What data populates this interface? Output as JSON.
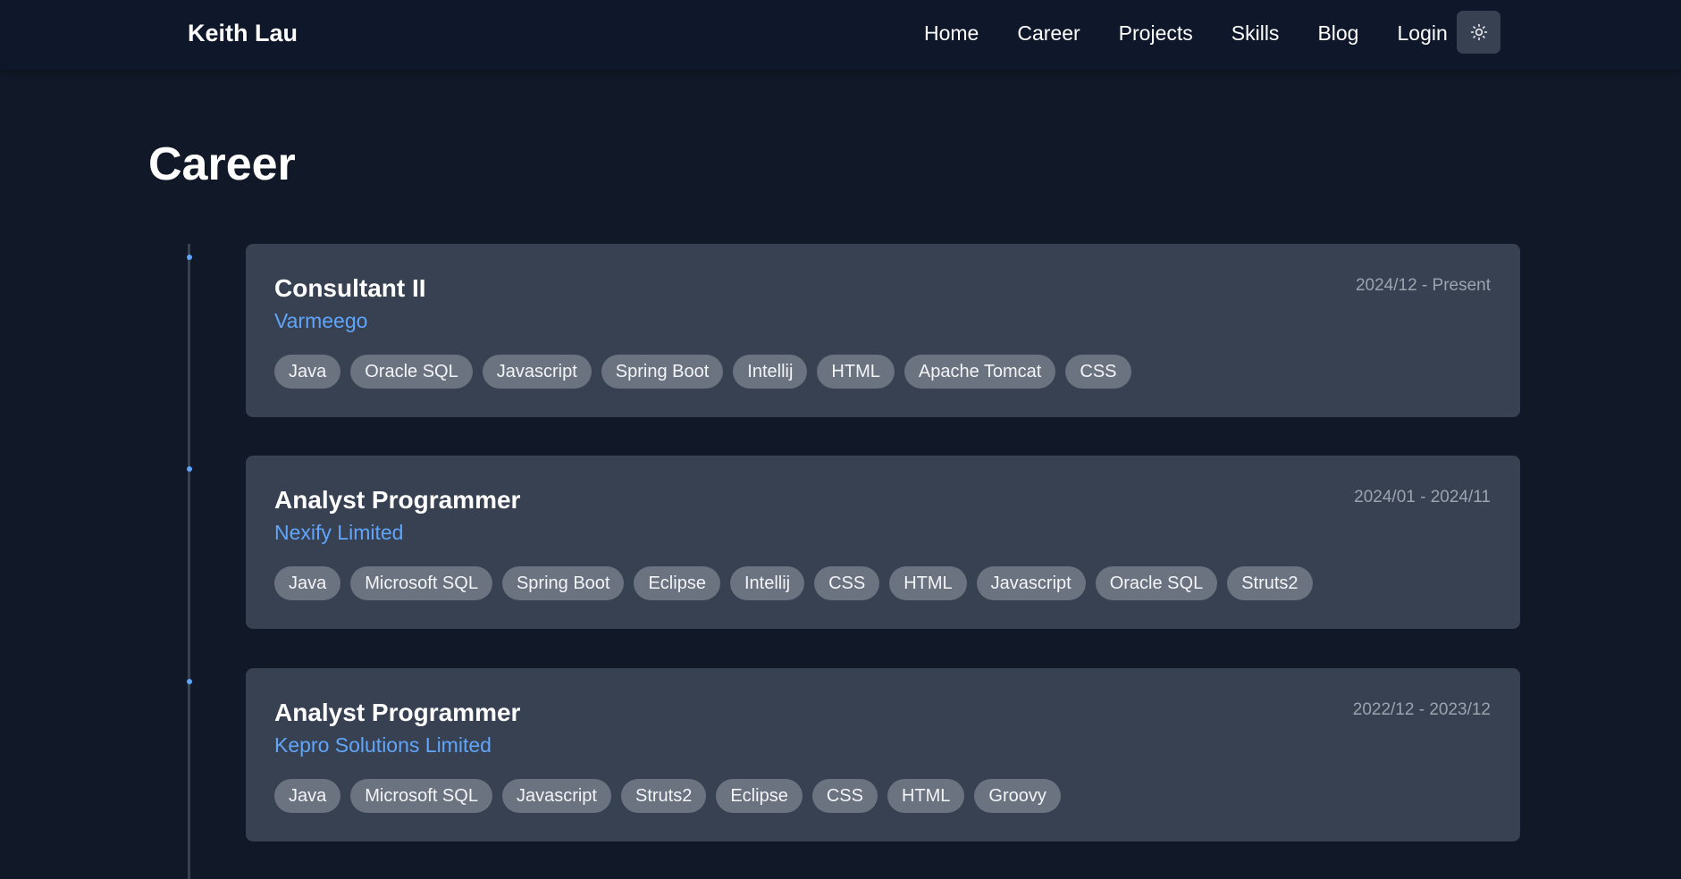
{
  "navbar": {
    "brand": "Keith Lau",
    "links": [
      "Home",
      "Career",
      "Projects",
      "Skills",
      "Blog",
      "Login"
    ],
    "theme_toggle_icon": "sun-icon"
  },
  "page": {
    "title": "Career"
  },
  "colors": {
    "background": "#111827",
    "navbar": "#0f172a",
    "card": "#374151",
    "accent": "#60a5fa",
    "tag": "#6b7280",
    "date": "#9ca3af"
  },
  "career": [
    {
      "title": "Consultant II",
      "company": "Varmeego",
      "date": "2024/12 - Present",
      "tags": [
        "Java",
        "Oracle SQL",
        "Javascript",
        "Spring Boot",
        "Intellij",
        "HTML",
        "Apache Tomcat",
        "CSS"
      ]
    },
    {
      "title": "Analyst Programmer",
      "company": "Nexify Limited",
      "date": "2024/01 - 2024/11",
      "tags": [
        "Java",
        "Microsoft SQL",
        "Spring Boot",
        "Eclipse",
        "Intellij",
        "CSS",
        "HTML",
        "Javascript",
        "Oracle SQL",
        "Struts2"
      ]
    },
    {
      "title": "Analyst Programmer",
      "company": "Kepro Solutions Limited",
      "date": "2022/12 - 2023/12",
      "tags": [
        "Java",
        "Microsoft SQL",
        "Javascript",
        "Struts2",
        "Eclipse",
        "CSS",
        "HTML",
        "Groovy"
      ]
    }
  ]
}
